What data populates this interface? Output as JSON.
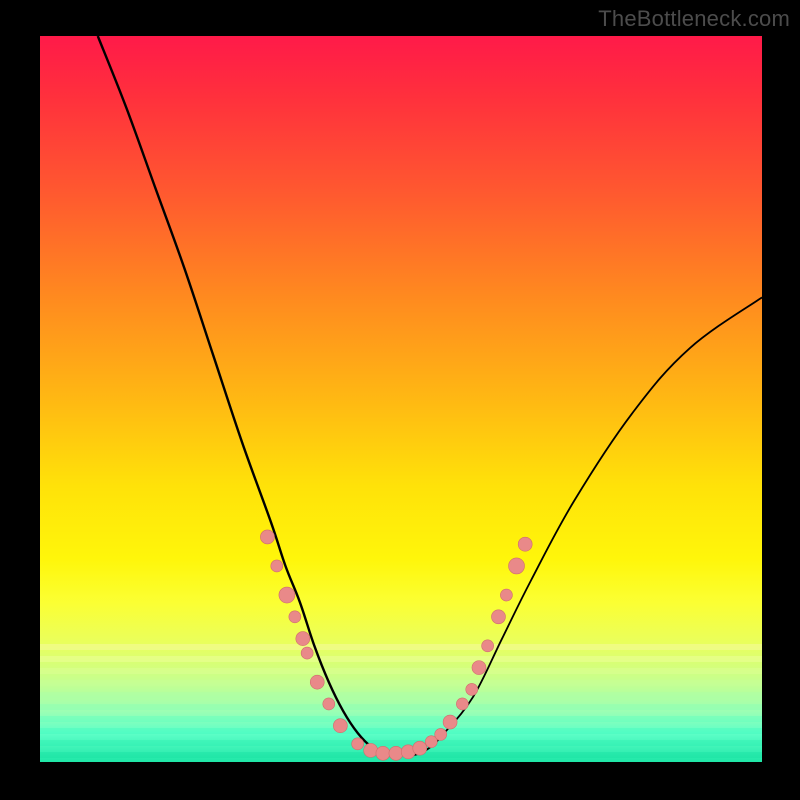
{
  "watermark": "TheBottleneck.com",
  "colors": {
    "dot_fill": "#e98989",
    "dot_stroke": "#d06d6d",
    "curve": "#000000"
  },
  "chart_data": {
    "type": "line",
    "title": "",
    "xlabel": "",
    "ylabel": "",
    "xlim": [
      0,
      100
    ],
    "ylim": [
      0,
      100
    ],
    "series": [
      {
        "name": "curve",
        "x": [
          8,
          12,
          16,
          20,
          24,
          28,
          32,
          34,
          36,
          38,
          40,
          42,
          44,
          46,
          48,
          50,
          52,
          54,
          56,
          60,
          64,
          68,
          74,
          82,
          90,
          100
        ],
        "y": [
          100,
          90,
          79,
          68,
          56,
          44,
          33,
          27,
          22,
          16,
          11,
          7,
          4,
          2,
          1,
          1,
          1,
          2,
          4,
          9,
          17,
          25,
          36,
          48,
          57,
          64
        ]
      }
    ],
    "points": [
      {
        "x": 31.5,
        "y": 31,
        "r": 7
      },
      {
        "x": 32.8,
        "y": 27,
        "r": 6
      },
      {
        "x": 34.2,
        "y": 23,
        "r": 8
      },
      {
        "x": 35.3,
        "y": 20,
        "r": 6
      },
      {
        "x": 36.4,
        "y": 17,
        "r": 7
      },
      {
        "x": 37.0,
        "y": 15,
        "r": 6
      },
      {
        "x": 38.4,
        "y": 11,
        "r": 7
      },
      {
        "x": 40.0,
        "y": 8,
        "r": 6
      },
      {
        "x": 41.6,
        "y": 5,
        "r": 7
      },
      {
        "x": 44.0,
        "y": 2.5,
        "r": 6
      },
      {
        "x": 45.8,
        "y": 1.6,
        "r": 7
      },
      {
        "x": 47.5,
        "y": 1.2,
        "r": 7
      },
      {
        "x": 49.3,
        "y": 1.2,
        "r": 7
      },
      {
        "x": 51.0,
        "y": 1.4,
        "r": 7
      },
      {
        "x": 52.6,
        "y": 1.9,
        "r": 7
      },
      {
        "x": 54.2,
        "y": 2.8,
        "r": 6
      },
      {
        "x": 55.5,
        "y": 3.8,
        "r": 6
      },
      {
        "x": 56.8,
        "y": 5.5,
        "r": 7
      },
      {
        "x": 58.5,
        "y": 8,
        "r": 6
      },
      {
        "x": 59.8,
        "y": 10,
        "r": 6
      },
      {
        "x": 60.8,
        "y": 13,
        "r": 7
      },
      {
        "x": 62.0,
        "y": 16,
        "r": 6
      },
      {
        "x": 63.5,
        "y": 20,
        "r": 7
      },
      {
        "x": 64.6,
        "y": 23,
        "r": 6
      },
      {
        "x": 66.0,
        "y": 27,
        "r": 8
      },
      {
        "x": 67.2,
        "y": 30,
        "r": 7
      }
    ]
  }
}
